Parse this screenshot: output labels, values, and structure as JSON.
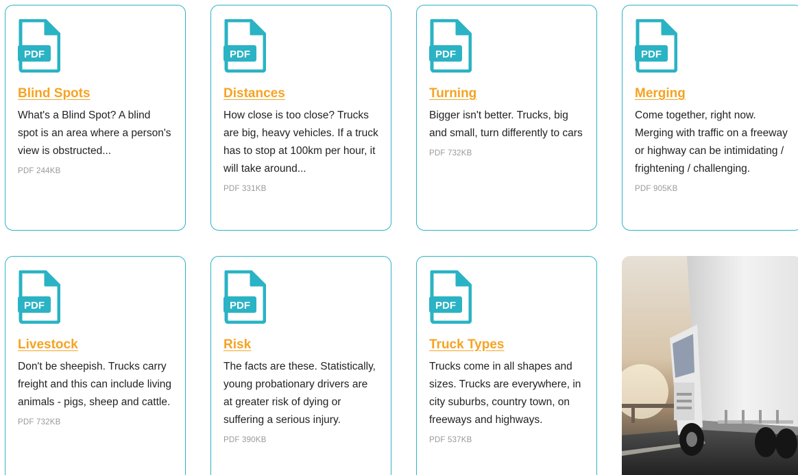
{
  "cards": [
    {
      "title": "Blind Spots",
      "description": "What's a Blind Spot? A blind spot is an area where a person's view is obstructed...",
      "meta": "PDF 244KB"
    },
    {
      "title": "Distances",
      "description": "How close is too close? Trucks are big, heavy vehicles. If a truck has to stop at 100km per hour, it will take around...",
      "meta": "PDF 331KB"
    },
    {
      "title": "Turning",
      "description": "Bigger isn't better. Trucks, big and small, turn differently to cars",
      "meta": "PDF 732KB"
    },
    {
      "title": "Merging",
      "description": "Come together, right now. Merging with traffic on a freeway or highway can be intimidating / frightening / challenging.",
      "meta": "PDF 905KB"
    },
    {
      "title": "Livestock",
      "description": "Don't be sheepish. Trucks carry freight and this can include living animals - pigs, sheep and cattle.",
      "meta": "PDF 732KB"
    },
    {
      "title": "Risk",
      "description": "The facts are these. Statistically, young probationary drivers are at greater risk of dying or suffering a serious injury.",
      "meta": "PDF 390KB"
    },
    {
      "title": "Truck Types",
      "description": "Trucks come in all shapes and sizes. Trucks are everywhere, in city suburbs, country town, on freeways and highways.",
      "meta": "PDF 537KB"
    }
  ],
  "icon": {
    "name": "pdf-file-icon",
    "label": "PDF",
    "color": "#2ab3c4"
  },
  "colors": {
    "accent": "#2ab3c4",
    "link": "#f5a323"
  }
}
